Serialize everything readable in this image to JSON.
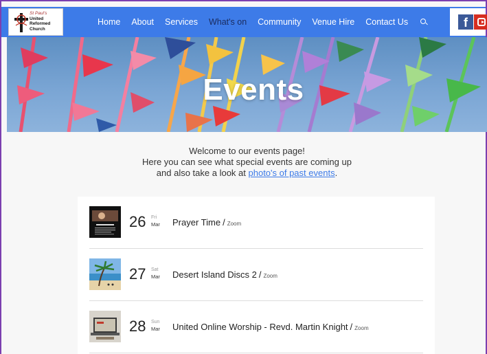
{
  "logo": {
    "line1": "St Paul's",
    "line2": "United",
    "line3": "Reformed",
    "line4": "Church"
  },
  "nav": {
    "items": [
      {
        "label": "Home"
      },
      {
        "label": "About"
      },
      {
        "label": "Services"
      },
      {
        "label": "What's on"
      },
      {
        "label": "Community"
      },
      {
        "label": "Venue Hire"
      },
      {
        "label": "Contact Us"
      }
    ],
    "active_index": 3,
    "accent_color": "#3d7be8",
    "active_color": "#1a2b5e",
    "search_icon": "search-icon"
  },
  "social": {
    "facebook_label": "f",
    "icons": [
      "facebook-icon",
      "youtube-icon"
    ]
  },
  "hero": {
    "title": "Events"
  },
  "intro": {
    "line1": "Welcome to our events page!",
    "line2": "Here you can see what special events are coming up",
    "line3_prefix": "and also take a look at ",
    "link_text": "photo's of past events",
    "line3_suffix": "."
  },
  "events": [
    {
      "day": "26",
      "weekday": "Fri",
      "month": "Mar",
      "title": "Prayer Time",
      "separator": "/",
      "location": "Zoom",
      "thumb": "prayer-time-thumbnail"
    },
    {
      "day": "27",
      "weekday": "Sat",
      "month": "Mar",
      "title": "Desert Island Discs 2",
      "separator": "/",
      "location": "Zoom",
      "thumb": "desert-island-thumbnail"
    },
    {
      "day": "28",
      "weekday": "Sun",
      "month": "Mar",
      "title": "United Online Worship - Revd. Martin Knight",
      "separator": "/",
      "location": "Zoom",
      "thumb": "online-worship-thumbnail"
    }
  ]
}
